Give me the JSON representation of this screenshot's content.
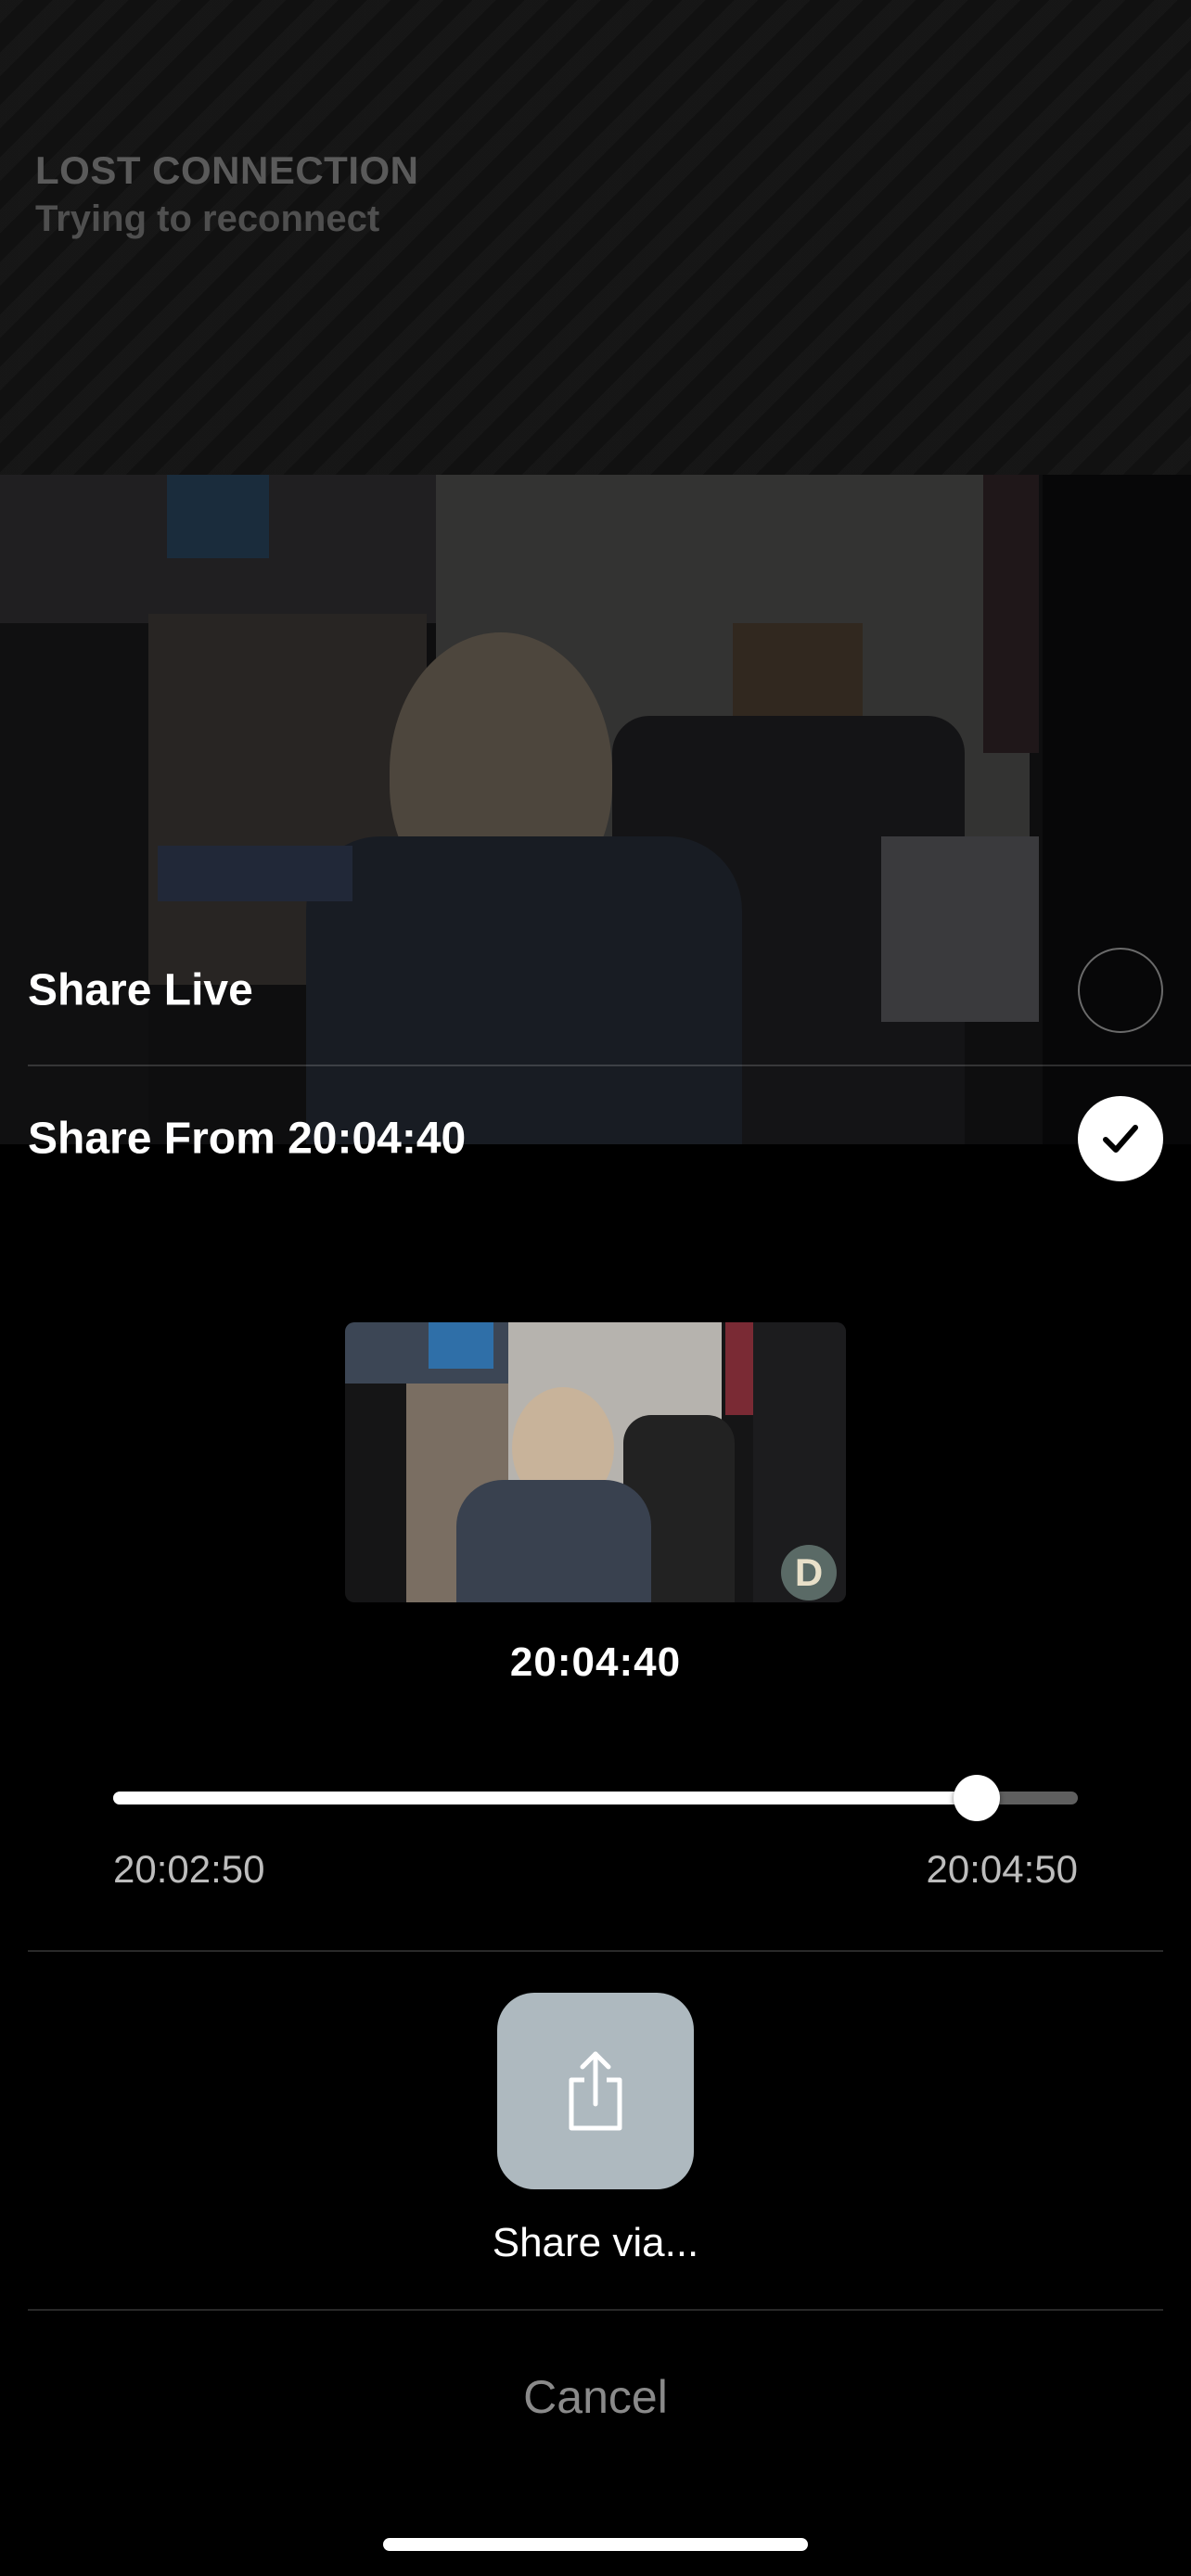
{
  "connection": {
    "title": "LOST CONNECTION",
    "subtitle": "Trying to reconnect"
  },
  "share_options": [
    {
      "label": "Share Live",
      "selected": false
    },
    {
      "label": "Share From 20:04:40",
      "selected": true
    }
  ],
  "preview": {
    "timestamp": "20:04:40",
    "logo_letter": "D"
  },
  "scrubber": {
    "start_label": "20:02:50",
    "end_label": "20:04:50",
    "position_fraction": 0.895
  },
  "share_via": {
    "label": "Share via...",
    "icon": "share-icon"
  },
  "cancel_label": "Cancel",
  "colors": {
    "background": "#000000",
    "share_button": "#aeb9bf",
    "cancel_text": "#8a8a8a"
  }
}
